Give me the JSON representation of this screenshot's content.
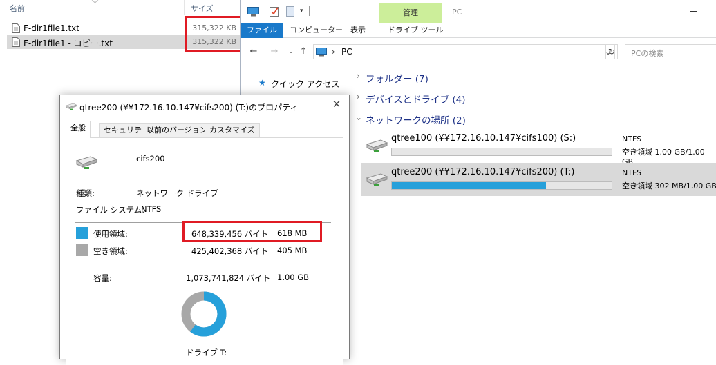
{
  "file_list": {
    "headers": {
      "name": "名前",
      "size": "サイズ"
    },
    "files": [
      {
        "name": "F-dir1file1.txt",
        "size": "315,322 KB"
      },
      {
        "name": "F-dir1file1 - コピー.txt",
        "size": "315,322 KB"
      }
    ]
  },
  "pc_window": {
    "title": "PC",
    "manage_tab": "管理",
    "ribbon_tabs": [
      "ファイル",
      "コンピューター",
      "表示",
      "ドライブ ツール"
    ],
    "address": "PC",
    "search_placeholder": "PCの検索",
    "nav": {
      "quick_access": "クイック アクセス"
    },
    "groups": {
      "folders": "フォルダー (7)",
      "devices": "デバイスとドライブ (4)",
      "network": "ネットワークの場所 (2)"
    },
    "drives": [
      {
        "name": "qtree100 (¥¥172.16.10.147¥cifs100) (S:)",
        "fs": "NTFS",
        "free": "空き領域 1.00 GB/1.00 GB",
        "used_fraction": 0.0
      },
      {
        "name": "qtree200 (¥¥172.16.10.147¥cifs200) (T:)",
        "fs": "NTFS",
        "free": "空き領域 302 MB/1.00 GB",
        "used_fraction": 0.7
      }
    ]
  },
  "dialog": {
    "title": "qtree200 (¥¥172.16.10.147¥cifs200) (T:)のプロパティ",
    "tabs": [
      "全般",
      "セキュリティ",
      "以前のバージョン",
      "カスタマイズ"
    ],
    "drive_label": "cifs200",
    "type_label": "種類:",
    "type_value": "ネットワーク ドライブ",
    "fs_label": "ファイル システム:",
    "fs_value": "NTFS",
    "used": {
      "label": "使用領域:",
      "bytes": "648,339,456 バイト",
      "size": "618 MB",
      "color": "#26a0da"
    },
    "free": {
      "label": "空き領域:",
      "bytes": "425,402,368 バイト",
      "size": "405 MB",
      "color": "#a8a8a8"
    },
    "capacity": {
      "label": "容量:",
      "bytes": "1,073,741,824 バイト",
      "size": "1.00 GB"
    },
    "drive_caption": "ドライブ T:",
    "used_fraction": 0.6038
  },
  "colors": {
    "highlight": "#e01b24",
    "accent": "#1979ca",
    "manage": "#ccee9a"
  }
}
